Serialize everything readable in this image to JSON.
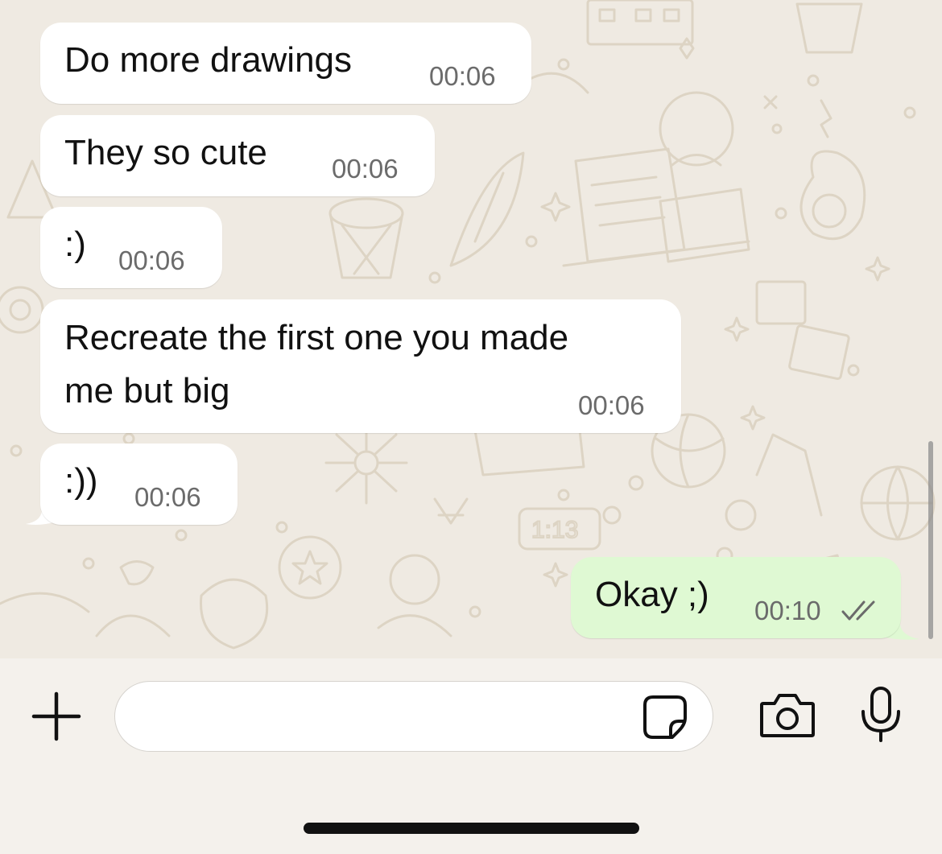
{
  "messages": [
    {
      "direction": "incoming",
      "text": "Do more drawings",
      "time": "00:06"
    },
    {
      "direction": "incoming",
      "text": "They so cute",
      "time": "00:06"
    },
    {
      "direction": "incoming",
      "text": ":)",
      "time": "00:06"
    },
    {
      "direction": "incoming",
      "lines": [
        "Recreate the first one you made",
        "me but big"
      ],
      "time": "00:06"
    },
    {
      "direction": "incoming",
      "text": ":))",
      "time": "00:06"
    },
    {
      "direction": "outgoing",
      "text": "Okay ;)",
      "time": "00:10",
      "status": "read-double-check"
    }
  ],
  "composer": {
    "placeholder": "",
    "icons": [
      "plus-icon",
      "sticker-icon",
      "camera-icon",
      "microphone-icon"
    ]
  },
  "colors": {
    "chat_background": "#efeae2",
    "incoming_bubble": "#ffffff",
    "outgoing_bubble": "#dff9d3",
    "composer_background": "#f4f1ec",
    "timestamp": "#6b6b6b"
  }
}
